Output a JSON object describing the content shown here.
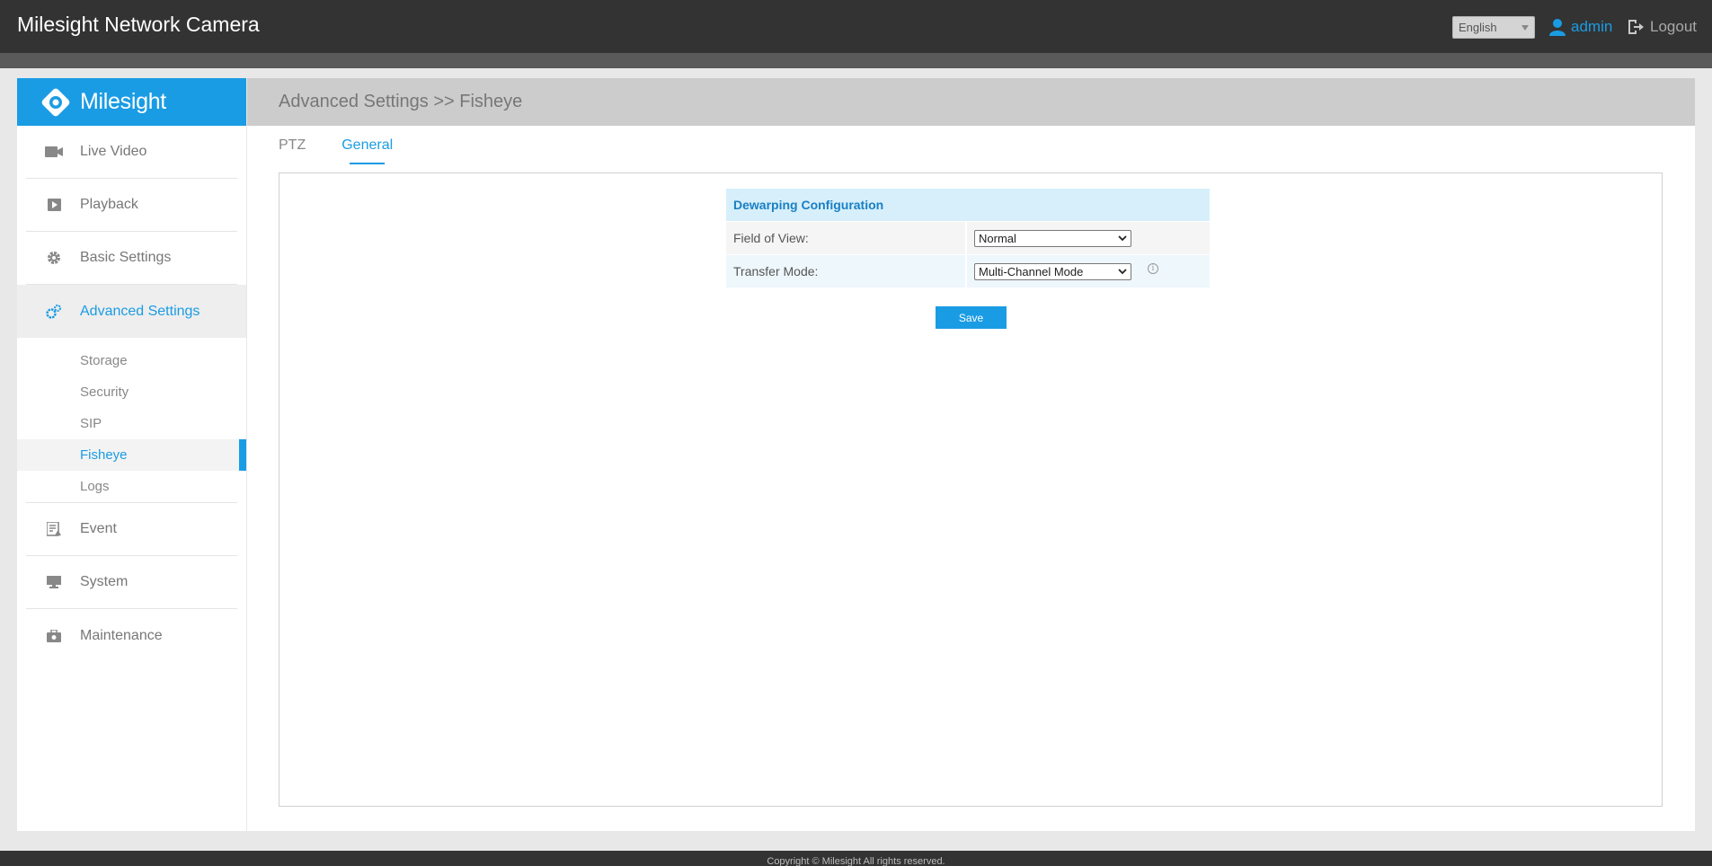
{
  "header": {
    "app_title": "Milesight Network Camera",
    "language": "English",
    "user": "admin",
    "logout_label": "Logout"
  },
  "sidebar": {
    "brand": "Milesight",
    "items": [
      {
        "label": "Live Video",
        "icon": "video-camera-icon"
      },
      {
        "label": "Playback",
        "icon": "playback-icon"
      },
      {
        "label": "Basic Settings",
        "icon": "gear-icon"
      },
      {
        "label": "Advanced Settings",
        "icon": "gears-icon",
        "active": true
      },
      {
        "label": "Event",
        "icon": "event-icon"
      },
      {
        "label": "System",
        "icon": "monitor-icon"
      },
      {
        "label": "Maintenance",
        "icon": "toolbox-icon"
      }
    ],
    "sub_items": [
      "Storage",
      "Security",
      "SIP",
      "Fisheye",
      "Logs"
    ],
    "active_sub": "Fisheye"
  },
  "main": {
    "breadcrumb": "Advanced Settings >> Fisheye",
    "tabs": [
      "PTZ",
      "General"
    ],
    "active_tab": "General",
    "config": {
      "title": "Dewarping Configuration",
      "fields": [
        {
          "label": "Field of View:",
          "value": "Normal"
        },
        {
          "label": "Transfer Mode:",
          "value": "Multi-Channel Mode"
        }
      ],
      "save_label": "Save"
    }
  },
  "footer": {
    "copyright": "Copyright © Milesight All rights reserved."
  },
  "colors": {
    "accent": "#1a9ce4",
    "topbar": "#333333",
    "header_bg": "#cccccc"
  }
}
